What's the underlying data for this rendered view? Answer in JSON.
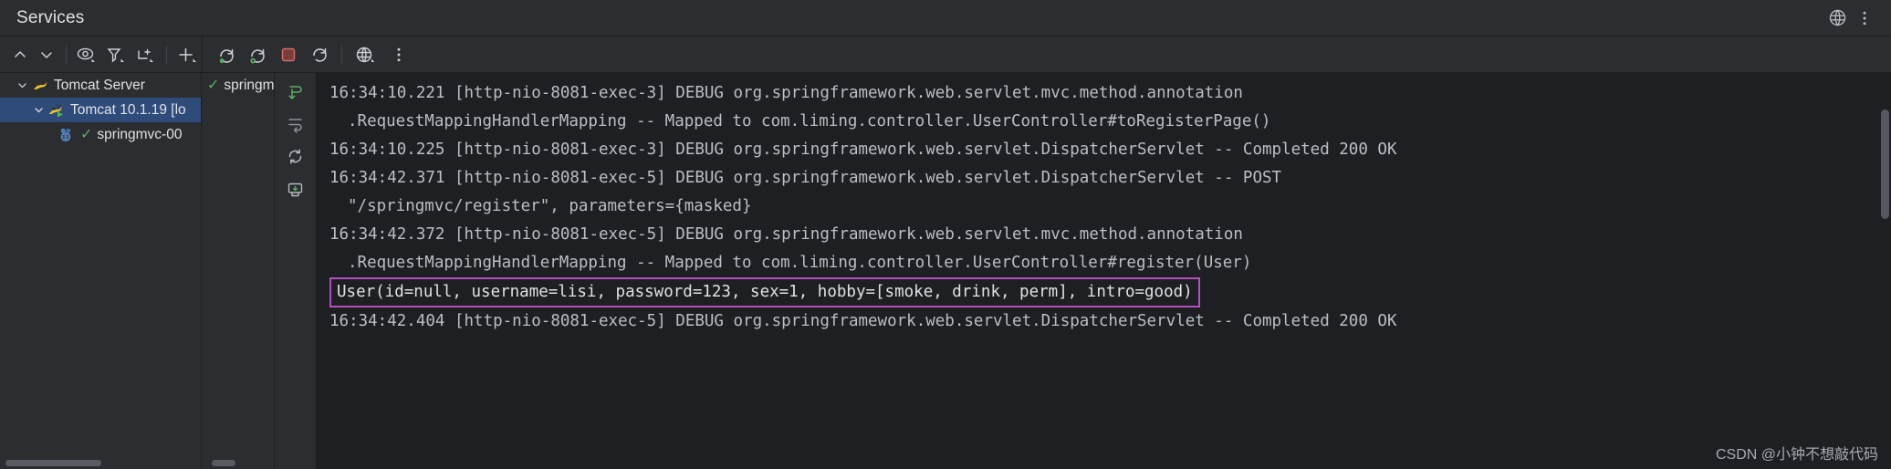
{
  "window": {
    "title": "Services",
    "header_icons": [
      {
        "name": "help-icon",
        "glyph": "?"
      },
      {
        "name": "more-options-icon",
        "glyph": "⋮"
      }
    ]
  },
  "toolbar": {
    "left_group": [
      {
        "name": "expand-all-icon",
        "label": "Expand All"
      },
      {
        "name": "collapse-all-icon",
        "label": "Collapse All"
      },
      {
        "name": "show-services-icon",
        "label": "Show Services"
      },
      {
        "name": "filter-icon",
        "label": "Filter"
      },
      {
        "name": "new-group-icon",
        "label": "Group"
      },
      {
        "name": "add-icon",
        "label": "Add Service"
      }
    ],
    "right_group": [
      {
        "name": "rerun-icon",
        "label": "Rerun"
      },
      {
        "name": "rerun-debug-icon",
        "label": "Rerun with Debug"
      },
      {
        "name": "stop-icon",
        "label": "Stop"
      },
      {
        "name": "restart-icon",
        "label": "Restart"
      },
      {
        "name": "open-browser-icon",
        "label": "Open in Browser"
      },
      {
        "name": "more-icon",
        "label": "More"
      }
    ]
  },
  "tree": {
    "items": [
      {
        "label": "Tomcat Server",
        "icon": "tomcat-icon",
        "expanded": true,
        "level": 0,
        "selected": false,
        "status": ""
      },
      {
        "label": "Tomcat 10.1.19 [lo",
        "icon": "tomcat-running-icon",
        "expanded": true,
        "level": 1,
        "selected": true,
        "status": ""
      },
      {
        "label": "springmvc-00",
        "icon": "artifact-icon",
        "expanded": false,
        "level": 2,
        "selected": false,
        "status": "check"
      }
    ]
  },
  "run_tabs": {
    "items": [
      {
        "label": "springmv",
        "status": "check"
      }
    ]
  },
  "console_gutter": {
    "buttons": [
      {
        "name": "scroll-to-end-icon",
        "label": "Scroll to End"
      },
      {
        "name": "soft-wrap-icon",
        "label": "Soft-Wrap"
      },
      {
        "name": "refresh-icon",
        "label": "Refresh"
      },
      {
        "name": "print-icon",
        "label": "Export"
      }
    ]
  },
  "console": {
    "lines": [
      {
        "text": "16:34:10.221 [http-nio-8081-exec-3] DEBUG org.springframework.web.servlet.mvc.method.annotation",
        "cont": false,
        "highlight": false
      },
      {
        "text": ".RequestMappingHandlerMapping -- Mapped to com.liming.controller.UserController#toRegisterPage()",
        "cont": true,
        "highlight": false
      },
      {
        "text": "16:34:10.225 [http-nio-8081-exec-3] DEBUG org.springframework.web.servlet.DispatcherServlet -- Completed 200 OK",
        "cont": false,
        "highlight": false
      },
      {
        "text": "16:34:42.371 [http-nio-8081-exec-5] DEBUG org.springframework.web.servlet.DispatcherServlet -- POST",
        "cont": false,
        "highlight": false
      },
      {
        "text": "\"/springmvc/register\", parameters={masked}",
        "cont": true,
        "highlight": false
      },
      {
        "text": "16:34:42.372 [http-nio-8081-exec-5] DEBUG org.springframework.web.servlet.mvc.method.annotation",
        "cont": false,
        "highlight": false
      },
      {
        "text": ".RequestMappingHandlerMapping -- Mapped to com.liming.controller.UserController#register(User)",
        "cont": true,
        "highlight": false
      },
      {
        "text": "User(id=null, username=lisi, password=123, sex=1, hobby=[smoke, drink, perm], intro=good)",
        "cont": false,
        "highlight": true
      },
      {
        "text": "16:34:42.404 [http-nio-8081-exec-5] DEBUG org.springframework.web.servlet.DispatcherServlet -- Completed 200 OK",
        "cont": false,
        "highlight": false
      }
    ],
    "highlight_color": "#b44fc0"
  },
  "watermark": {
    "text": "CSDN @小钟不想敲代码"
  }
}
